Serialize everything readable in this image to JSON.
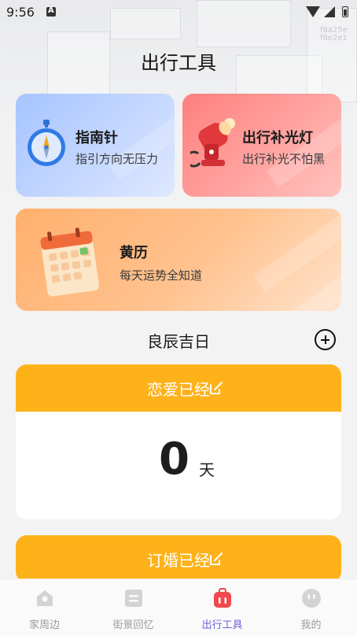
{
  "status_bar": {
    "time": "9:56",
    "watermark_line1": "f8a25e",
    "watermark_line2": "f8e2e1"
  },
  "page": {
    "title": "出行工具"
  },
  "tools": [
    {
      "title": "指南针",
      "subtitle": "指引方向无压力",
      "icon": "compass-icon"
    },
    {
      "title": "出行补光灯",
      "subtitle": "出行补光不怕黑",
      "icon": "lamp-icon"
    },
    {
      "title": "黄历",
      "subtitle": "每天运势全知道",
      "icon": "calendar-icon"
    }
  ],
  "section": {
    "title": "良辰吉日"
  },
  "counters": [
    {
      "label": "恋爱已经",
      "value": "0",
      "unit": "天"
    },
    {
      "label": "订婚已经"
    }
  ],
  "nav": {
    "items": [
      {
        "label": "家周边",
        "icon": "location-pin-icon"
      },
      {
        "label": "街景回忆",
        "icon": "list-card-icon"
      },
      {
        "label": "出行工具",
        "icon": "suitcase-icon",
        "active": true
      },
      {
        "label": "我的",
        "icon": "face-icon"
      }
    ]
  },
  "colors": {
    "accent": "#6b63d9",
    "counter_header": "#feb21a",
    "compass_card": "#a6c4ff",
    "light_card": "#ff7f7f",
    "almanac_card": "#ffb06d"
  }
}
